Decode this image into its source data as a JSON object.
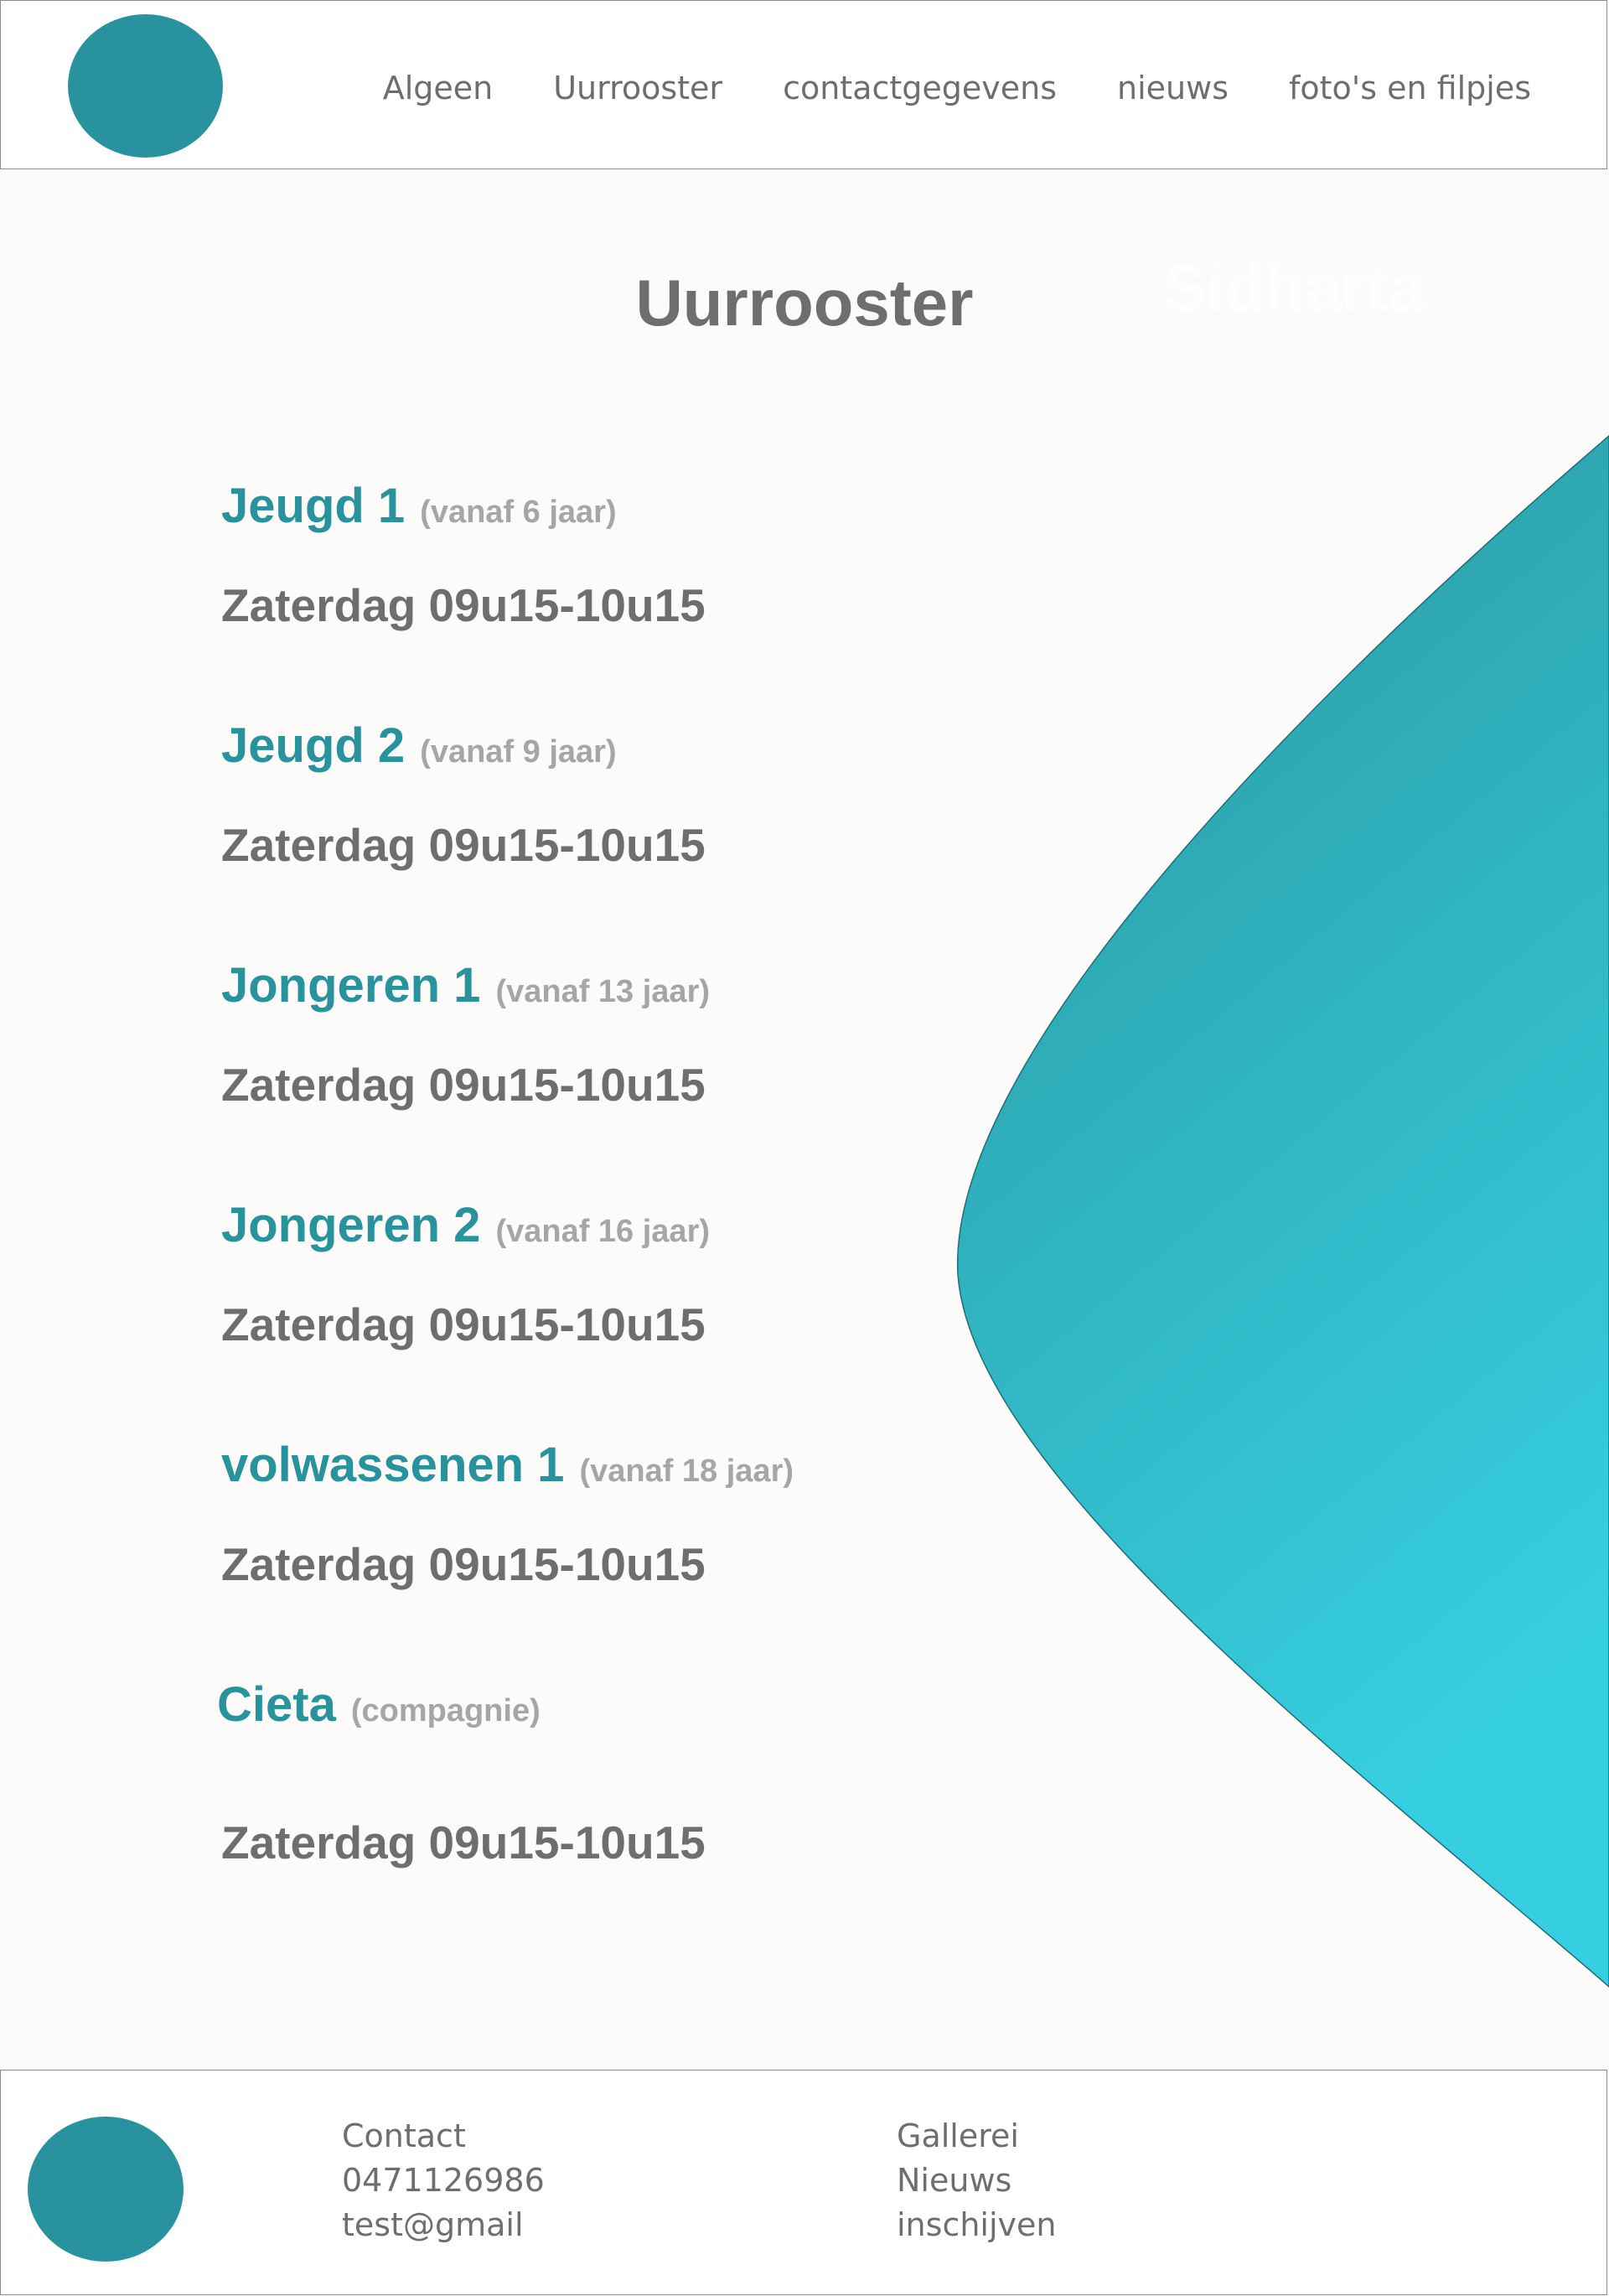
{
  "nav": {
    "items": [
      "Algeen",
      "Uurrooster",
      "contactgegevens",
      "nieuws",
      "foto's en filpjes"
    ]
  },
  "watermark": "Sidharta",
  "page_title": "Uurrooster",
  "groups": [
    {
      "name": "Jeugd 1",
      "note": "(vanaf 6 jaar)",
      "time": "Zaterdag 09u15-10u15"
    },
    {
      "name": "Jeugd 2",
      "note": "(vanaf 9 jaar)",
      "time": "Zaterdag 09u15-10u15"
    },
    {
      "name": "Jongeren 1",
      "note": "(vanaf 13 jaar)",
      "time": "Zaterdag 09u15-10u15"
    },
    {
      "name": "Jongeren 2",
      "note": "(vanaf 16 jaar)",
      "time": "Zaterdag 09u15-10u15"
    },
    {
      "name": "volwassenen 1",
      "note": "(vanaf 18 jaar)",
      "time": "Zaterdag 09u15-10u15"
    },
    {
      "name": "Cieta",
      "note": "(compagnie)",
      "time": "Zaterdag 09u15-10u15"
    }
  ],
  "footer": {
    "contact": [
      "Contact",
      "0471126986",
      "test@gmail"
    ],
    "links": [
      "Gallerei",
      "Nieuws",
      "inschijven"
    ]
  },
  "colors": {
    "accent": "#28939f",
    "wave_top": "#2a979f",
    "wave_bottom": "#36cfe1",
    "text": "#6e6e6e",
    "muted": "#a6a6a6"
  }
}
